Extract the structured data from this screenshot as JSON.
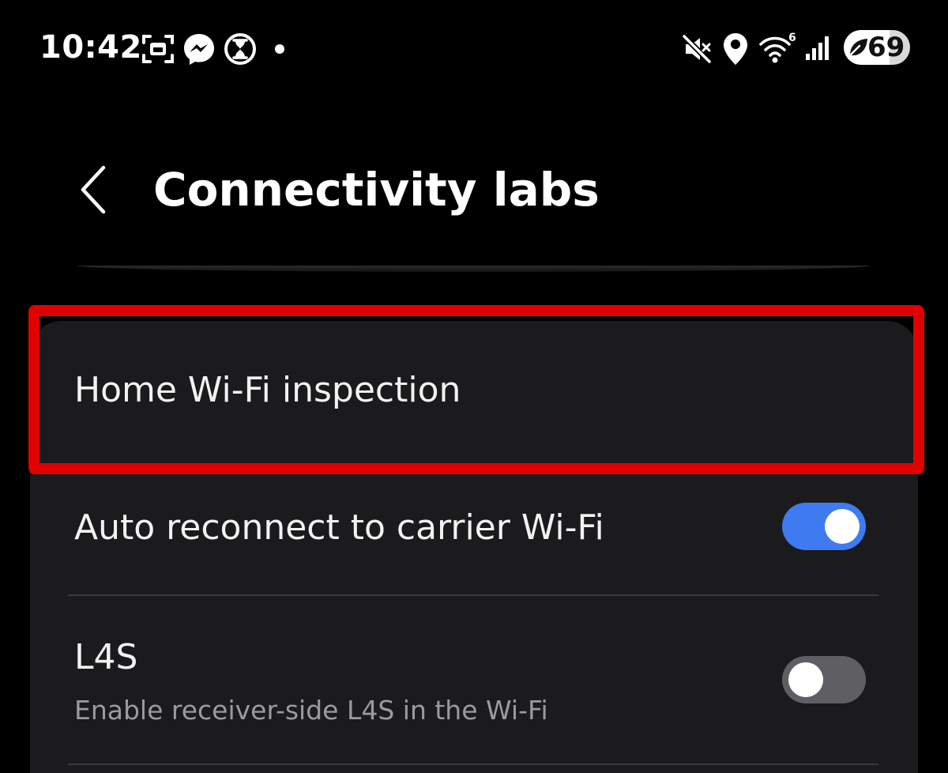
{
  "status_bar": {
    "time": "10:42",
    "battery_level": "69",
    "icons": [
      "screenshot-icon",
      "messenger-icon",
      "hourglass-icon",
      "notification-dot-icon",
      "mute-icon",
      "location-icon",
      "wifi-6-icon",
      "cellular-signal-icon",
      "battery-saver-leaf-icon"
    ],
    "wifi_standard": "6"
  },
  "header": {
    "title": "Connectivity labs"
  },
  "settings": [
    {
      "label": "Home Wi-Fi inspection"
    },
    {
      "label": "Auto reconnect to carrier Wi-Fi",
      "toggle": "on"
    },
    {
      "label": "L4S",
      "description": "Enable receiver-side L4S in the Wi-Fi",
      "toggle": "off"
    }
  ],
  "colors": {
    "background": "#000000",
    "card": "#1b1b1e",
    "toggle_on": "#3e7bf0",
    "toggle_off": "#5f5f63",
    "highlight": "#e00000"
  }
}
